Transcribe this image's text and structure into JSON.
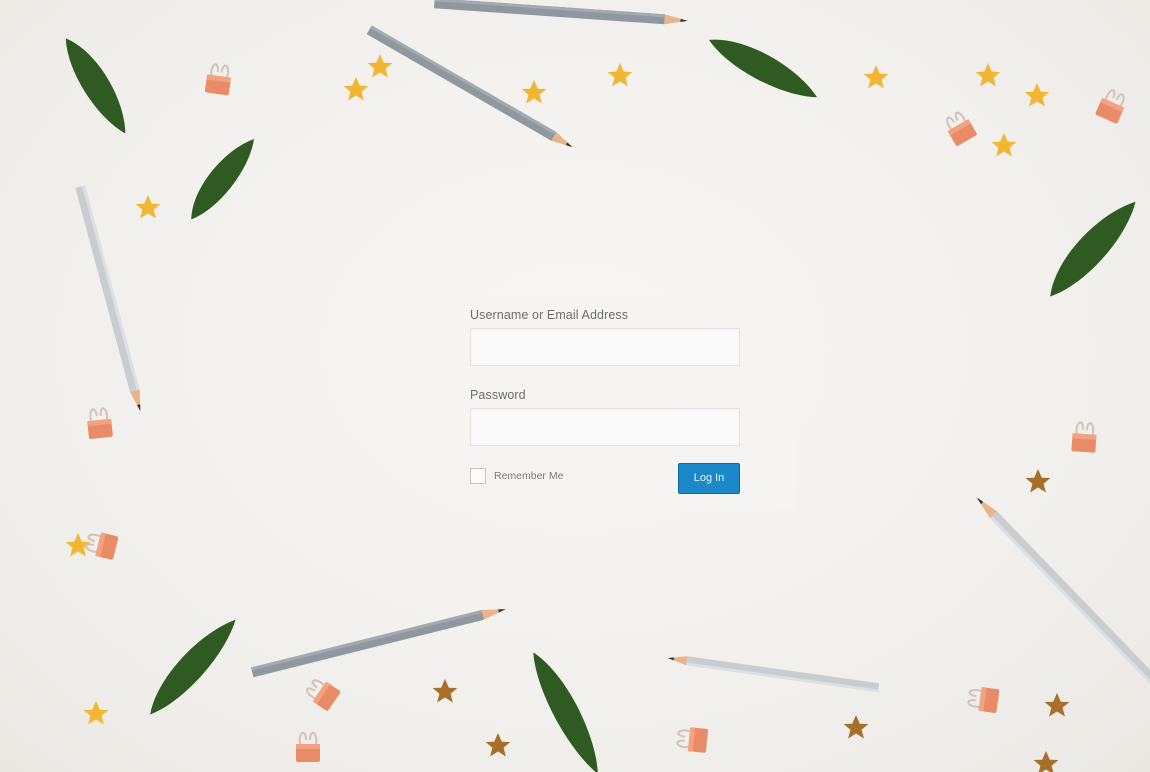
{
  "login_form": {
    "username_label": "Username or Email Address",
    "username_value": "",
    "password_label": "Password",
    "password_value": "",
    "remember_label": "Remember Me",
    "remember_checked": false,
    "submit_label": "Log In"
  },
  "colors": {
    "background": "#f1efec",
    "button": "#1a88c9",
    "leaf": "#2f5a22",
    "pencil_gray": "#8c969c",
    "star": "#f2b632",
    "clip": "#e98b66"
  },
  "decorations": {
    "items": [
      "leaf",
      "pencil",
      "star",
      "binder-clip"
    ]
  }
}
